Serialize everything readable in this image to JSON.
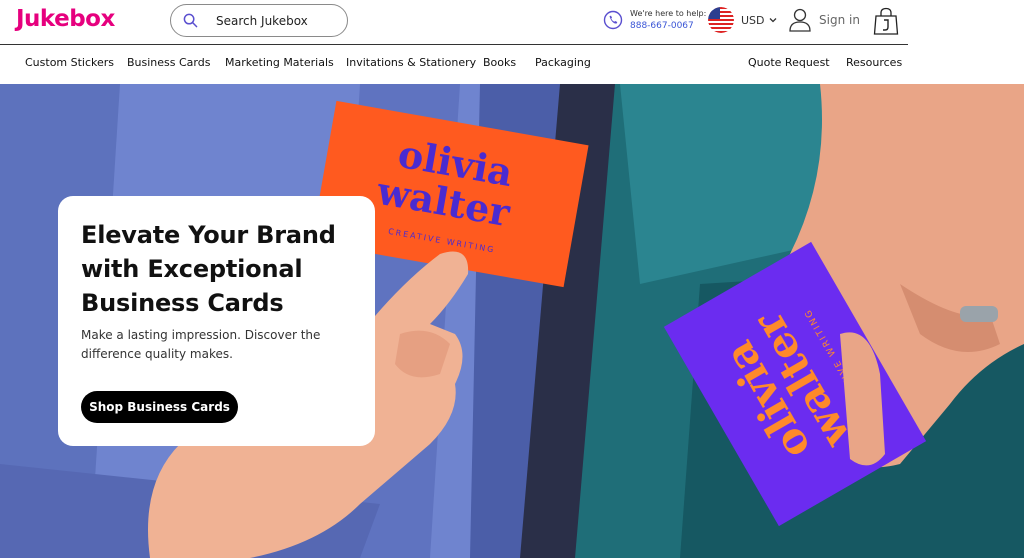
{
  "header": {
    "logo": "Jukebox",
    "search_placeholder": "Search Jukebox",
    "help_label": "We're here to help:",
    "help_phone": "888-667-0067",
    "currency": "USD",
    "signin": "Sign in"
  },
  "nav": {
    "left": [
      "Custom Stickers",
      "Business Cards",
      "Marketing Materials",
      "Invitations & Stationery",
      "Books",
      "Packaging"
    ],
    "right": [
      "Quote Request",
      "Resources"
    ]
  },
  "hero": {
    "headline": "Elevate Your Brand with Exceptional Business Cards",
    "subtext": "Make a lasting impression. Discover the difference quality makes.",
    "cta": "Shop Business Cards",
    "card1_name_line1": "olivia",
    "card1_name_line2": "walter",
    "card1_tagline": "CREATIVE WRITING",
    "card2_name_line1": "olivia",
    "card2_name_line2": "walter",
    "card2_tagline": "CREATIVE WRITING"
  },
  "colors": {
    "brand": "#e6007e",
    "link": "#3a55d6",
    "cta_bg": "#000000",
    "card_orange": "#ff5a1f",
    "card_purple": "#6b2cf0"
  },
  "icons": [
    "search-icon",
    "phone-icon",
    "us-flag-icon",
    "chevron-down-icon",
    "user-icon",
    "shopping-bag-icon"
  ]
}
